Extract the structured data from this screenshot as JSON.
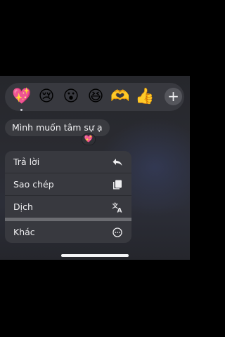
{
  "reactions": {
    "emojis": [
      "💖",
      "😢",
      "😮",
      "😆",
      "🫶",
      "👍"
    ],
    "selected_index": 0,
    "more_label": "+"
  },
  "message": {
    "text": "Mình muốn tâm sự ạ",
    "reaction": "💖"
  },
  "menu": {
    "items": [
      {
        "label": "Trả lời",
        "icon": "reply-icon"
      },
      {
        "label": "Sao chép",
        "icon": "copy-icon"
      },
      {
        "label": "Dịch",
        "icon": "translate-icon"
      },
      {
        "label": "Khác",
        "icon": "more-circle-icon"
      }
    ]
  }
}
